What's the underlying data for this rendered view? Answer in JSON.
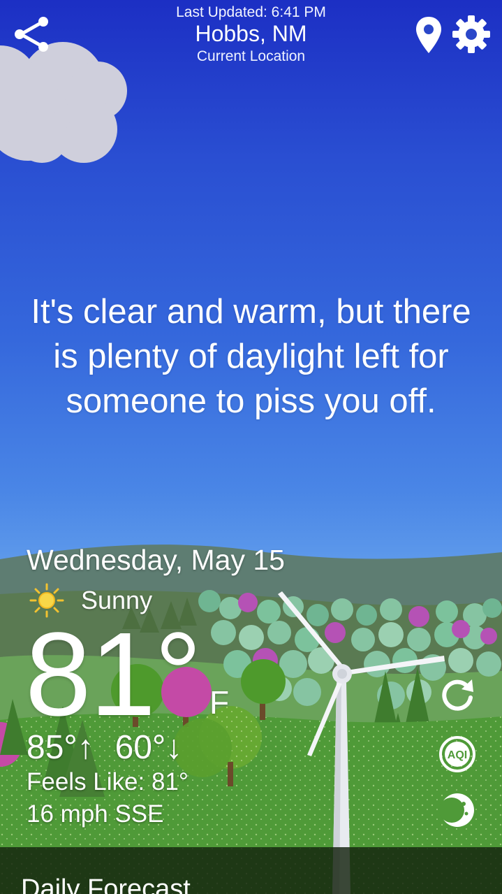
{
  "header": {
    "last_updated": "Last Updated: 6:41 PM",
    "city": "Hobbs, NM",
    "location_label": "Current Location"
  },
  "message": "It's clear and warm, but there is plenty of daylight left for someone to piss you off.",
  "weather": {
    "date": "Wednesday, May 15",
    "condition": "Sunny",
    "condition_icon": "sun-icon",
    "temperature": "81°",
    "unit": "F",
    "high": "85°↑",
    "low": "60°↓",
    "feels_like": "Feels Like: 81°",
    "wind": "16 mph SSE"
  },
  "actions": {
    "share_icon": "share-icon",
    "location_icon": "location-pin-icon",
    "settings_icon": "gear-icon",
    "refresh_icon": "refresh-icon",
    "aqi_label": "AQI",
    "moon_icon": "moon-phase-icon"
  },
  "daily_forecast": {
    "title": "Daily Forecast"
  },
  "colors": {
    "sky_top": "#1c2fc4",
    "sky_bottom": "#82b6ef",
    "grass": "#4f9a38",
    "bar": "#14220e"
  }
}
